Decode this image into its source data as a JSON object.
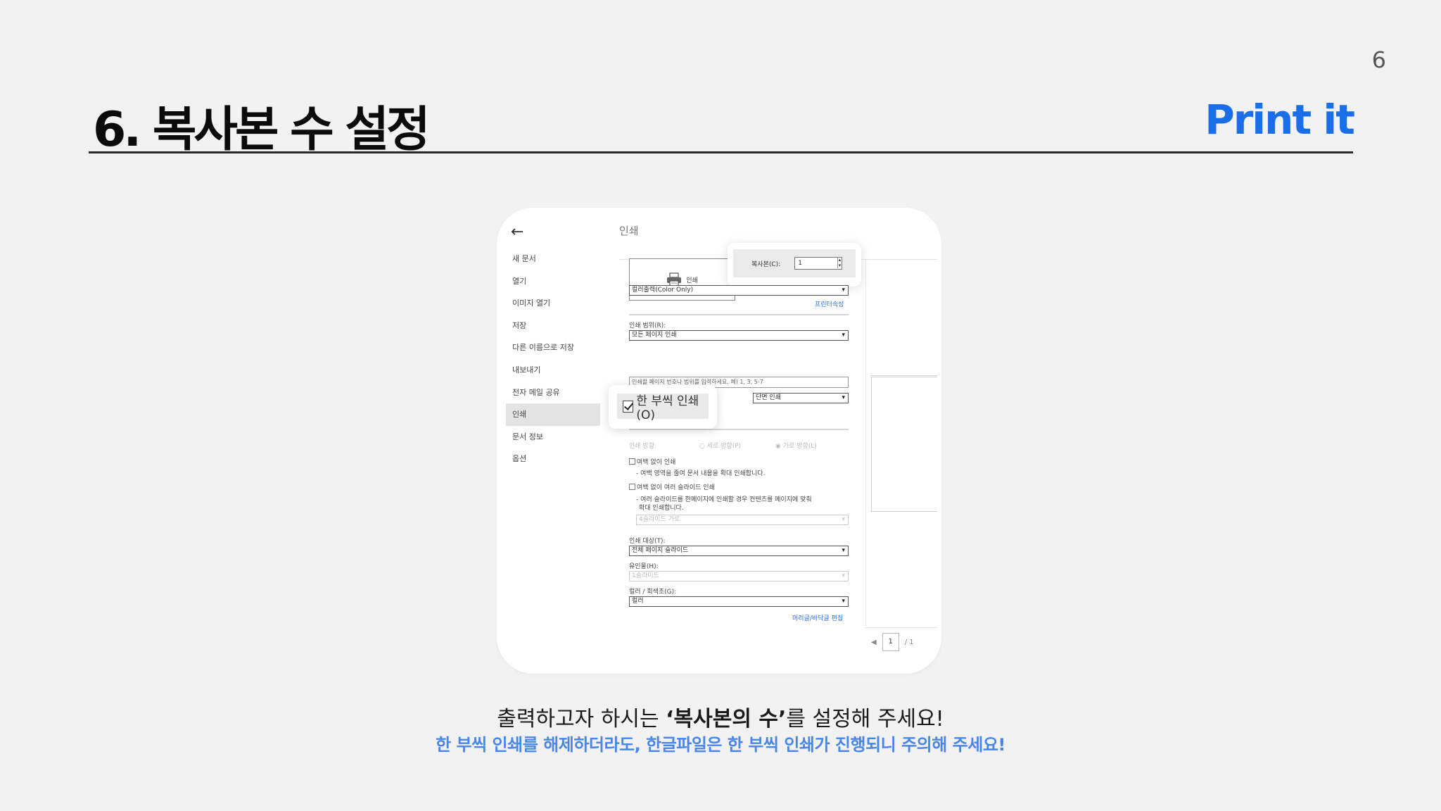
{
  "slide": {
    "page_number": "6",
    "title": "6. 복사본 수 설정",
    "brand": "Print it"
  },
  "screenshot": {
    "back_icon": "arrow-left-icon",
    "menu": [
      {
        "label": "새 문서"
      },
      {
        "label": "열기"
      },
      {
        "label": "이미지 열기"
      },
      {
        "label": "저장"
      },
      {
        "label": "다른 이름으로 저장"
      },
      {
        "label": "내보내기"
      },
      {
        "label": "전자 메일 공유"
      },
      {
        "label": "인쇄",
        "active": true
      },
      {
        "label": "문서 정보"
      },
      {
        "label": "옵션"
      }
    ],
    "dialog_title": "인쇄",
    "printer_label": "인쇄",
    "copies_label": "복사본(C):",
    "copies_value": "1",
    "printer_select": "컬러출력(Color Only)",
    "printer_properties_link": "프린터속성",
    "print_range_label": "인쇄 범위(R):",
    "print_range_value": "모든 페이지 인쇄",
    "page_input_hint": "인쇄할 페이지 번호나 범위를 입력하세요. 예) 1, 3, 5-7",
    "collate_label": "한 부씩 인쇄(O)",
    "duplex_value": "단면 인쇄",
    "orientation_label": "인쇄 방향:",
    "orientation_portrait": "세로 방향(P)",
    "orientation_landscape": "가로 방향(L)",
    "no_margin_label": "여백 없이 인쇄",
    "no_margin_desc": "- 여백 영역을 줄여 문서 내용을 확대 인쇄합니다.",
    "no_margin_slides_label": "여백 없이 여러 슬라이드 인쇄",
    "no_margin_slides_desc1": "- 여러 슬라이드를 한페이지에 인쇄할 경우 컨텐츠를 페이지에 맞춰",
    "no_margin_slides_desc2": "확대 인쇄합니다.",
    "slides_per_page_value": "4슬라이드 가로",
    "print_target_label": "인쇄 대상(T):",
    "print_target_value": "전체 페이지 슬라이드",
    "handouts_label": "유인물(H):",
    "handouts_value": "1슬라이드",
    "color_label": "컬러 / 회색조(G):",
    "color_value": "컬러",
    "header_footer_link": "머리글/바닥글 편집",
    "pager_current": "1",
    "pager_total": "/ 1"
  },
  "caption": {
    "main_prefix": "출력하고자 하시는 ",
    "main_bold": "‘복사본의 수’",
    "main_suffix": "를 설정해 주세요!",
    "sub": "한 부씩 인쇄를 해제하더라도, 한글파일은 한 부씩 인쇄가 진행되니 주의해 주세요!"
  }
}
